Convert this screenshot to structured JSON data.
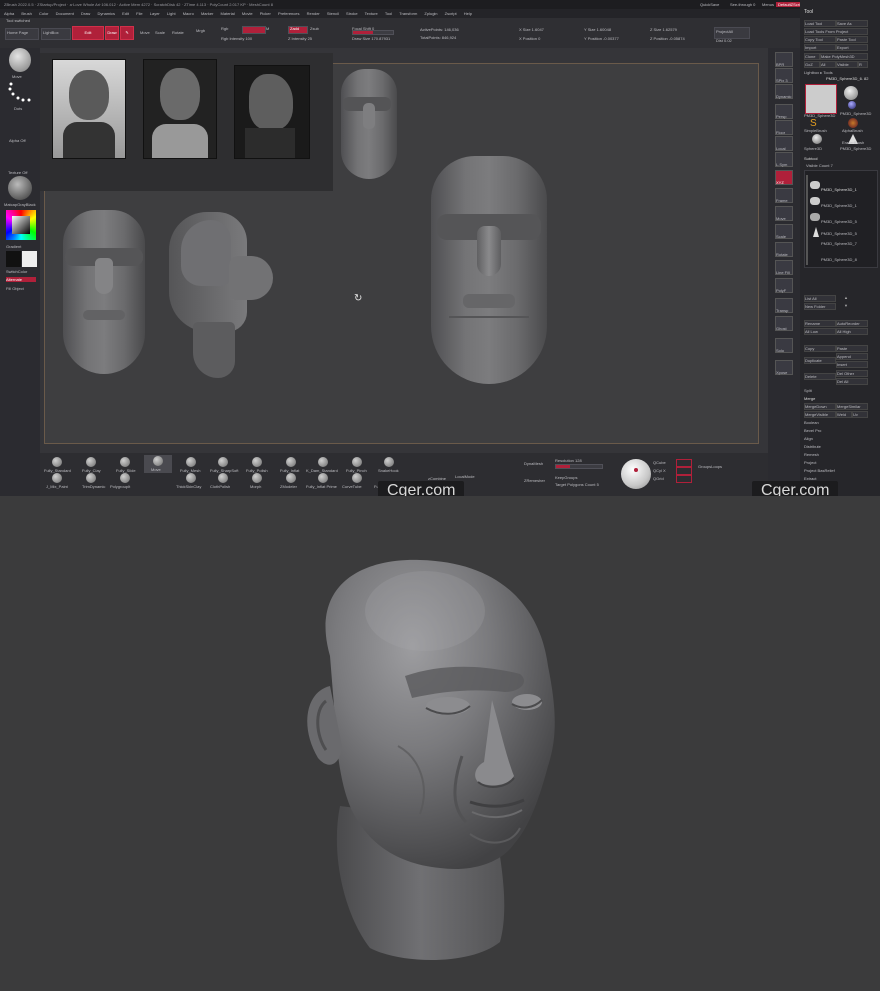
{
  "title": {
    "text": "ZBrush 2022.0.5 · ZStartup/Project · a·Love Whole Ari·106.012 · Active Mem 4272 · ScratchDisk 42 · ZTime 4.113 · PolyCount 2.017 KP · MeshCount 8",
    "quicksave": "QuickSave",
    "seethrough": "See-through 0",
    "menus_label": "Menus",
    "default_script": "DefaultZScript"
  },
  "menu": [
    "Alpha",
    "Brush",
    "Color",
    "Document",
    "Draw",
    "Dynamics",
    "Edit",
    "File",
    "Layer",
    "Light",
    "Macro",
    "Marker",
    "Material",
    "Movie",
    "Picker",
    "Preferences",
    "Render",
    "Stencil",
    "Stroke",
    "Texture",
    "Tool",
    "Transform",
    "Zplugin",
    "Zscript",
    "Help"
  ],
  "toolbar": {
    "home_page": "Home Page",
    "lightbox": "LightBox",
    "edit": "Edit",
    "draw": "Draw",
    "move": "Move",
    "scale": "Scale",
    "rotate": "Rotate",
    "mrgb": "Mrgb",
    "rgb": "Rgb",
    "m": "M",
    "zadd": "Zadd",
    "zsub": "Zsub",
    "rgb_intensity": "Rgb Intensity 100",
    "z_intensity": "Z Intensity 25",
    "focal_shift": "Focal Shift 0",
    "draw_size": "Draw Size 170.87931",
    "active_points": "ActivePoints: 146,036",
    "total_points": "TotalPoints: 846,924",
    "x_scale": "X Size 1.6047",
    "y_scale": "Y Size 1.60048",
    "z_scale": "Z Size 1.62579",
    "x_position": "X Position 0",
    "y_position": "Y Position -0.00377",
    "z_position": "Z Position -0.05874",
    "project_all": "ProjectAll",
    "dist": "Dist 0.02",
    "tool_switched": "Tool switched"
  },
  "left_shelf": {
    "brush": "Move",
    "stroke": "Dots",
    "alpha": "Alpha Off",
    "texture": "Texture Off",
    "material": "MatcapGrayBlack",
    "gradient": "Gradient",
    "switch_color": "SwitchColor",
    "alternate": "Alternate",
    "fill_object": "Fill Object"
  },
  "right_shelf": [
    "BPR",
    "SPix 3",
    "Dynamic",
    "Persp",
    "Floor",
    "Local",
    "L.Sym",
    "XYZ",
    "Frame",
    "Move",
    "Scale",
    "Rotate",
    "Line Fill",
    "PolyF",
    "Transp",
    "Ghost",
    "Solo",
    "Xpose"
  ],
  "tool_panel": {
    "header": "Tool",
    "buttons": [
      "Load Tool",
      "Save As",
      "Load Tools From Project",
      "Copy Tool",
      "Paste Tool",
      "Import",
      "Export",
      "Clone",
      "Make PolyMesh3D",
      "GoZ",
      "All",
      "Visible",
      "R"
    ],
    "lightbox_tools": "Lightbox ▸ Tools",
    "current_tool": "PM3D_Sphere3D_6. 82",
    "tools": [
      "PM3D_Sphere3D",
      "PM3D_Sphere3D",
      "SimpleBrush",
      "AlphaBrush",
      "EraserBrush",
      "Sphere3D",
      "PM3D_Sphere3D"
    ],
    "subtool_header": "Subtool",
    "visible_count": "Visible Count 7",
    "subtools": [
      "PM3D_Sphere3D_1",
      "PM3D_Sphere3D_1",
      "PM3D_Sphere3D_5",
      "PM3D_Sphere3D_5",
      "PM3D_Sphere3D_7",
      "PM3D_Sphere3D_8"
    ],
    "list_all": "List All",
    "new_folder": "New Folder",
    "rename": "Rename",
    "autoreorder": "AutoReorder",
    "all_low": "All Low",
    "all_high": "All High",
    "copy": "Copy",
    "paste": "Paste",
    "duplicate": "Duplicate",
    "append": "Append",
    "insert": "Insert",
    "delete": "Delete",
    "del_other": "Del Other",
    "del_all": "Del All",
    "split": "Split",
    "merge": "Merge",
    "merge_down": "MergeDown",
    "merge_similar": "MergeSimilar",
    "merge_visible": "MergeVisible",
    "weld": "Weld",
    "uv": "Uv",
    "remesh": "Remesh",
    "extras": [
      "Boolean",
      "Bevel Pro",
      "Align",
      "Distribute",
      "Remesh",
      "Project",
      "Project BasRelief",
      "Extract"
    ]
  },
  "brushes_row1": [
    "Fully_Standard",
    "Fully_Clay",
    "Fully_Slide",
    "Move",
    "Fully_Mesh",
    "Fully_SharpSoft",
    "Fully_Polish",
    "Fully_Inflat",
    "K_Dam_Standard",
    "Fully_Pinch",
    "SnakeHook"
  ],
  "brushes_row2": [
    "J_Mix_Paint",
    "TrimDynamic",
    "PolygroupIt",
    "ThickSkinClay",
    "ClothPolish",
    "Morph",
    "ZModeler",
    "Fully_Inflat Prime",
    "CurveTube",
    "Fully_Dam",
    "zCombine"
  ],
  "bottom_panel": {
    "dynamesh": "DynaMesh",
    "resolution": "Resolution 128",
    "zremesher": "ZRemesher",
    "target_polygons": "Target Polygons Count 5",
    "keep_groups": "KeepGroups",
    "qcube": "QCube",
    "qcyl": "QCyl X",
    "qgrid": "QGrid",
    "groups_loops": "GroupsLoops",
    "local_mode": "LocalMode"
  },
  "watermark": "Cger.com",
  "colors": {
    "accent": "#b0203a",
    "bg": "#3b3b3c"
  }
}
